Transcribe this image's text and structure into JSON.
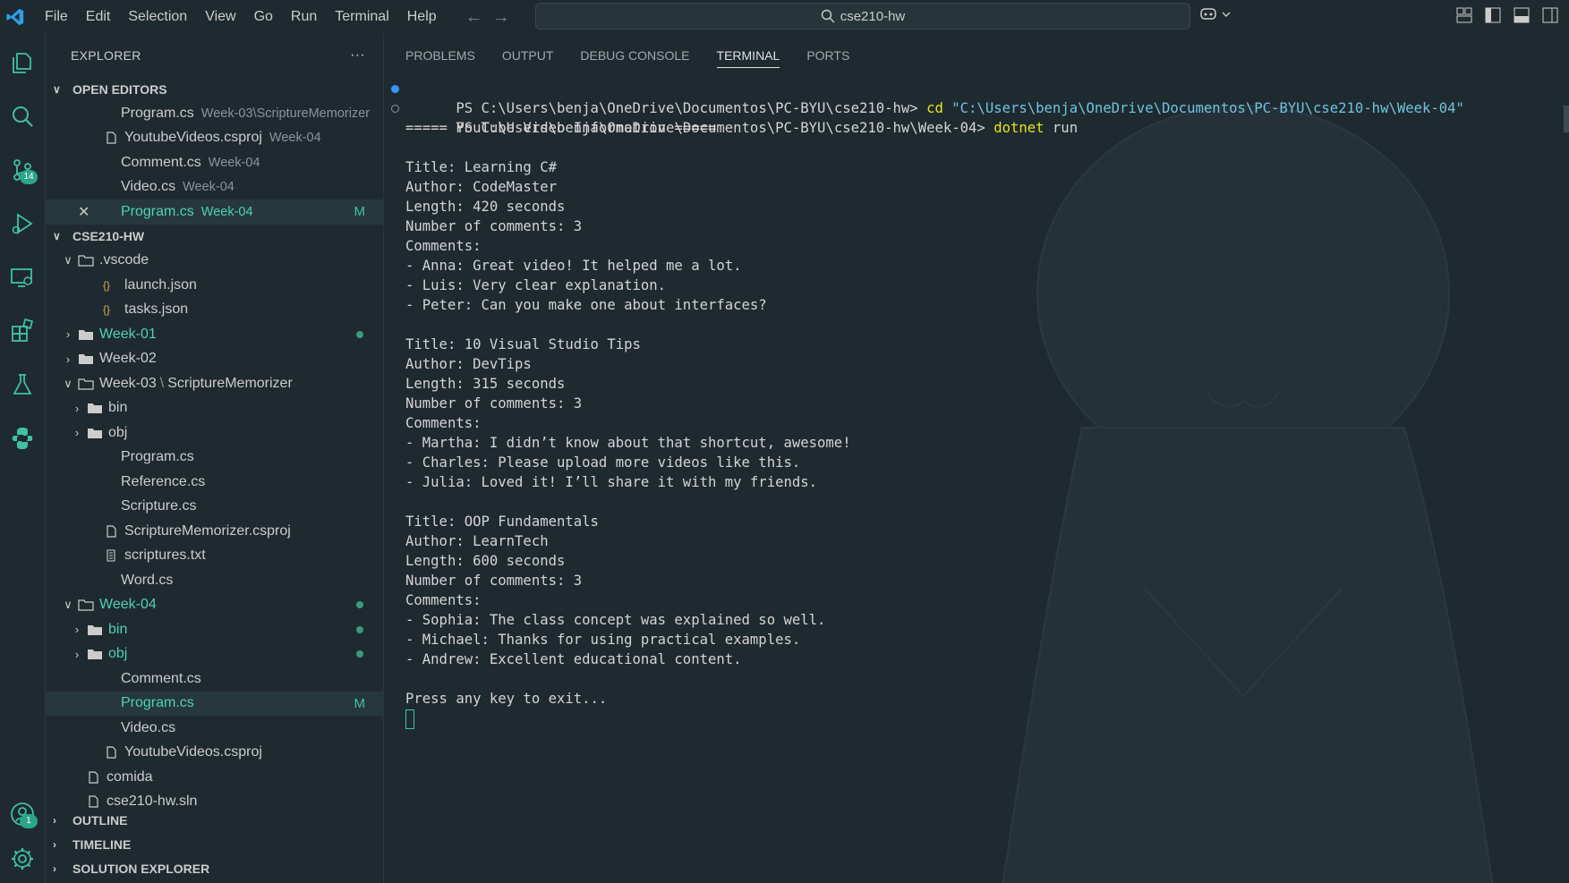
{
  "titlebar": {
    "menu": [
      "File",
      "Edit",
      "Selection",
      "View",
      "Go",
      "Run",
      "Terminal",
      "Help"
    ],
    "search_text": "cse210-hw"
  },
  "activitybar": {
    "source_control_badge": "14",
    "accounts_badge": "1"
  },
  "sidebar": {
    "title": "EXPLORER",
    "more": "···",
    "open_editors_label": "OPEN EDITORS",
    "open_editors": [
      {
        "name": "Program.cs",
        "desc": "Week-03\\ScriptureMemorizer",
        "status": ""
      },
      {
        "name": "YoutubeVideos.csproj",
        "desc": "Week-04",
        "status": ""
      },
      {
        "name": "Comment.cs",
        "desc": "Week-04",
        "status": ""
      },
      {
        "name": "Video.cs",
        "desc": "Week-04",
        "status": ""
      },
      {
        "name": "Program.cs",
        "desc": "Week-04",
        "status": "M"
      }
    ],
    "workspace_label": "CSE210-HW",
    "tree": {
      "vscode": ".vscode",
      "launch": "launch.json",
      "tasks": "tasks.json",
      "week01": "Week-01",
      "week02": "Week-02",
      "week03": "Week-03",
      "week03_sub": "ScriptureMemorizer",
      "w3_bin": "bin",
      "w3_obj": "obj",
      "w3_program": "Program.cs",
      "w3_reference": "Reference.cs",
      "w3_scripture": "Scripture.cs",
      "w3_csproj": "ScriptureMemorizer.csproj",
      "w3_txt": "scriptures.txt",
      "w3_word": "Word.cs",
      "week04": "Week-04",
      "w4_bin": "bin",
      "w4_obj": "obj",
      "w4_comment": "Comment.cs",
      "w4_program": "Program.cs",
      "w4_program_status": "M",
      "w4_video": "Video.cs",
      "w4_csproj": "YoutubeVideos.csproj",
      "comida": "comida",
      "sln": "cse210-hw.sln"
    },
    "outline_label": "OUTLINE",
    "timeline_label": "TIMELINE",
    "solution_label": "SOLUTION EXPLORER"
  },
  "panel": {
    "tabs": [
      "PROBLEMS",
      "OUTPUT",
      "DEBUG CONSOLE",
      "TERMINAL",
      "PORTS"
    ],
    "active_tab": "TERMINAL"
  },
  "terminal": {
    "prompt1": "PS C:\\Users\\benja\\OneDrive\\Documentos\\PC-BYU\\cse210-hw> ",
    "cmd1": "cd ",
    "arg1": "\"C:\\Users\\benja\\OneDrive\\Documentos\\PC-BYU\\cse210-hw\\Week-04\"",
    "prompt2": "PS C:\\Users\\benja\\OneDrive\\Documentos\\PC-BYU\\cse210-hw\\Week-04> ",
    "cmd2": "dotnet ",
    "arg2": "run",
    "output": [
      "===== YouTube Video Information =====",
      "",
      "Title: Learning C#",
      "Author: CodeMaster",
      "Length: 420 seconds",
      "Number of comments: 3",
      "Comments:",
      "- Anna: Great video! It helped me a lot.",
      "- Luis: Very clear explanation.",
      "- Peter: Can you make one about interfaces?",
      "",
      "Title: 10 Visual Studio Tips",
      "Author: DevTips",
      "Length: 315 seconds",
      "Number of comments: 3",
      "Comments:",
      "- Martha: I didn’t know about that shortcut, awesome!",
      "- Charles: Please upload more videos like this.",
      "- Julia: Loved it! I’ll share it with my friends.",
      "",
      "Title: OOP Fundamentals",
      "Author: LearnTech",
      "Length: 600 seconds",
      "Number of comments: 3",
      "Comments:",
      "- Sophia: The class concept was explained so well.",
      "- Michael: Thanks for using practical examples.",
      "- Andrew: Excellent educational content.",
      "",
      "Press any key to exit..."
    ]
  },
  "colors": {
    "accent": "#3fc1a2",
    "modified": "#4fd1b0",
    "command": "#e5e510",
    "string": "#6fc3df"
  }
}
